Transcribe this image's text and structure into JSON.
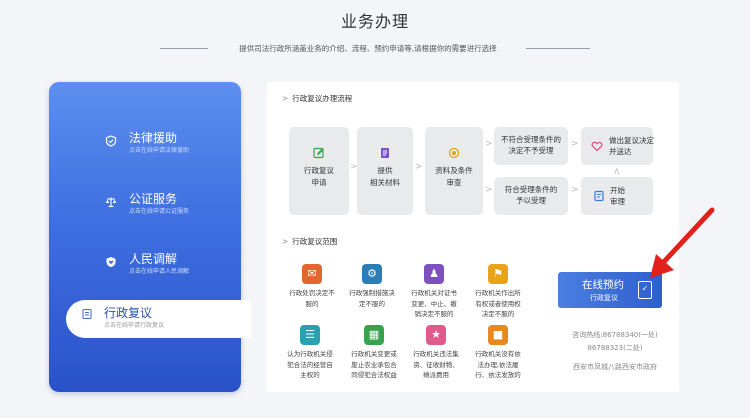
{
  "header": {
    "title": "业务办理",
    "subtitle": "提供司法行政所涵盖业务的介绍、流程、预约申请等,请根据你的需要进行选择"
  },
  "sidebar": {
    "items": [
      {
        "label": "法律援助",
        "desc": "点击在线申请法律援助",
        "icon": "shield-icon"
      },
      {
        "label": "公证服务",
        "desc": "点击在线申请公证服务",
        "icon": "scale-icon"
      },
      {
        "label": "人民调解",
        "desc": "点击在线申请人民调解",
        "icon": "shield-heart-icon"
      },
      {
        "label": "行政复议",
        "desc": "点击在线申请行政复议",
        "icon": "document-icon"
      }
    ]
  },
  "process": {
    "title": "行政复议办理流程",
    "steps": [
      {
        "lines": [
          "行政复议",
          "申请"
        ],
        "icon": "edit-icon",
        "color": "#3aa24d"
      },
      {
        "lines": [
          "提供",
          "相关材料"
        ],
        "icon": "file-icon",
        "color": "#7b4fc4"
      },
      {
        "lines": [
          "资料及条件",
          "审查"
        ],
        "icon": "review-icon",
        "color": "#e8a015"
      }
    ],
    "branches": [
      {
        "lines": [
          "不符合受理条件的",
          "决定不予受理"
        ]
      },
      {
        "lines": [
          "符合受理条件的",
          "予以受理"
        ]
      }
    ],
    "outcomes": [
      {
        "lines": [
          "做出复议决定",
          "并送达"
        ],
        "icon": "heart-icon",
        "color": "#e04a7a"
      },
      {
        "lines": [
          "开始",
          "审理"
        ],
        "icon": "audit-icon",
        "color": "#3b7be0"
      }
    ]
  },
  "scope": {
    "title": "行政复议范围",
    "items": [
      {
        "lines": [
          "行政处罚决定不",
          "服的"
        ],
        "color": "#e2682f"
      },
      {
        "lines": [
          "行政强制措施决",
          "定不服的"
        ],
        "color": "#2a7fb8"
      },
      {
        "lines": [
          "行政机关对证书",
          "变更、中止、撤",
          "销决定不服的"
        ],
        "color": "#7d4fc0"
      },
      {
        "lines": [
          "行政机关作出所",
          "有权或者使用权",
          "决定不服的"
        ],
        "color": "#e8a31b"
      },
      {
        "lines": [
          "认为行政机关侵",
          "犯合法的经营自",
          "主权的"
        ],
        "color": "#2aa0b0"
      },
      {
        "lines": [
          "行政机关变更或",
          "废止农业承包合",
          "同侵犯合法权益"
        ],
        "color": "#3aa24d"
      },
      {
        "lines": [
          "行政机关违法集",
          "资、征收财物、",
          "摊派费用"
        ],
        "color": "#e05a8a"
      },
      {
        "lines": [
          "行政机关没有依",
          "法办理,依法履",
          "行、依法发放的"
        ],
        "color": "#e88a1b"
      }
    ]
  },
  "reserve": {
    "label": "在线预约",
    "sublabel": "行政复议"
  },
  "contact": {
    "hotline1": "咨询热线:86788340(一处)",
    "hotline2": "86788323(二处)",
    "address": "西安市凤城八路西安市政府"
  }
}
